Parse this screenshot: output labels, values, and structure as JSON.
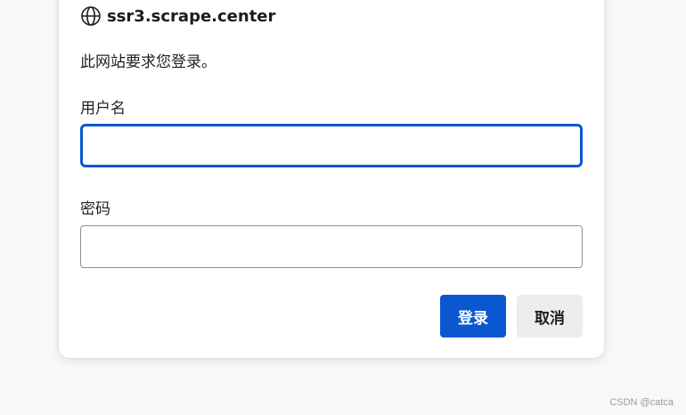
{
  "dialog": {
    "site": "ssr3.scrape.center",
    "site_icon": "globe-icon",
    "message": "此网站要求您登录。",
    "username_label": "用户名",
    "username_value": "",
    "password_label": "密码",
    "password_value": "",
    "login_button": "登录",
    "cancel_button": "取消"
  },
  "watermark": "CSDN @catca",
  "colors": {
    "accent": "#0b57d0",
    "cancel_bg": "#ededed",
    "page_bg": "#f7f8fa"
  }
}
